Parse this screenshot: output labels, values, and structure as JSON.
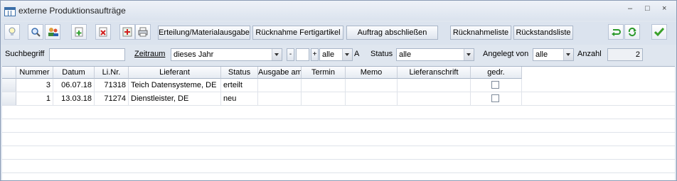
{
  "window": {
    "title": "externe Produktionsaufträge",
    "controls": [
      "–",
      "□",
      "×"
    ]
  },
  "toolbar": {
    "buttons": [
      {
        "icon": "lightbulb-icon"
      },
      {
        "icon": "search-icon"
      },
      {
        "icon": "users-icon"
      },
      {
        "icon": "new-document-icon"
      },
      {
        "icon": "delete-document-icon"
      },
      {
        "icon": "add-icon"
      },
      {
        "icon": "print-icon"
      }
    ],
    "text_buttons": [
      "Erteilung/Materialausgabe",
      "Rücknahme Fertigartikel",
      "Auftrag abschließen",
      "Rücknahmeliste",
      "Rückstandsliste"
    ],
    "right_icons": [
      "undo-icon",
      "refresh-icon",
      "confirm-icon"
    ]
  },
  "filters": {
    "suchbegriff_label": "Suchbegriff",
    "suchbegriff_value": "",
    "zeitraum_label": "Zeitraum",
    "zeitraum_value": "dieses Jahr",
    "minus": "-",
    "plus": "+",
    "range_value": "alle",
    "a_button": "A",
    "status_label": "Status",
    "status_value": "alle",
    "angelegt_label": "Angelegt von",
    "angelegt_value": "alle",
    "anzahl_label": "Anzahl",
    "anzahl_value": "2"
  },
  "table": {
    "columns": [
      "Nummer",
      "Datum",
      "Li.Nr.",
      "Lieferant",
      "Status",
      "Ausgabe am",
      "Termin",
      "Memo",
      "Lieferanschrift",
      "gedr."
    ],
    "rows": [
      {
        "nummer": "3",
        "datum": "06.07.18",
        "linr": "71318",
        "lieferant": "Teich Datensysteme, DE",
        "status": "erteilt",
        "ausgabe": "",
        "termin": "",
        "memo": "",
        "anschrift": "",
        "gedr": false
      },
      {
        "nummer": "1",
        "datum": "13.03.18",
        "linr": "71274",
        "lieferant": "Dienstleister, DE",
        "status": "neu",
        "ausgabe": "",
        "termin": "",
        "memo": "",
        "anschrift": "",
        "gedr": false
      }
    ]
  }
}
